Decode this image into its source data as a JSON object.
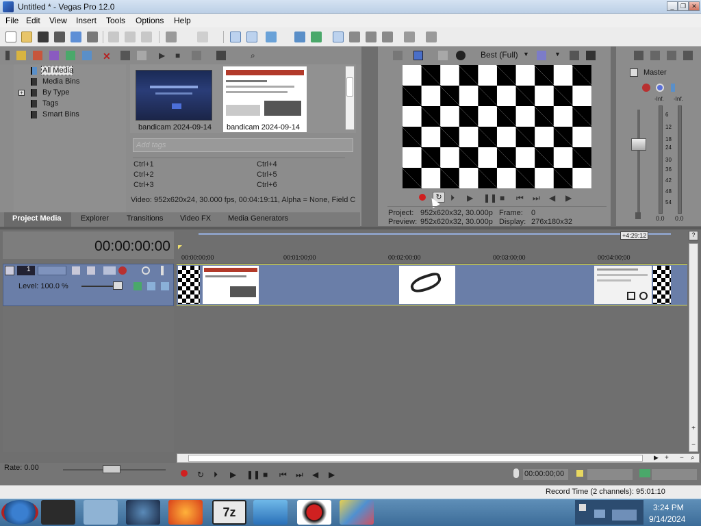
{
  "window": {
    "title": "Untitled * - Vegas Pro 12.0",
    "min": "_",
    "max": "❐",
    "close": "✕"
  },
  "menu": [
    "File",
    "Edit",
    "View",
    "Insert",
    "Tools",
    "Options",
    "Help"
  ],
  "explorer": {
    "tree": [
      "All Media",
      "Media Bins",
      "By Type",
      "Tags",
      "Smart Bins"
    ],
    "expand_glyph": "+",
    "thumbs": [
      {
        "label": "bandicam 2024-09-14"
      },
      {
        "label": "bandicam 2024-09-14"
      }
    ],
    "tags_placeholder": "Add tags",
    "shortcuts": [
      "Ctrl+1",
      "Ctrl+4",
      "Ctrl+2",
      "Ctrl+5",
      "Ctrl+3",
      "Ctrl+6"
    ],
    "info": "Video: 952x620x24, 30.000 fps, 00:04:19:11, Alpha = None, Field C"
  },
  "tabs": [
    "Project Media",
    "Explorer",
    "Transitions",
    "Video FX",
    "Media Generators"
  ],
  "preview": {
    "quality": "Best (Full)",
    "project_label": "Project:",
    "project_value": "952x620x32, 30.000p",
    "preview_label": "Preview:",
    "preview_value": "952x620x32, 30.000p",
    "frame_label": "Frame:",
    "frame_value": "0",
    "display_label": "Display:",
    "display_value": "276x180x32"
  },
  "mixer": {
    "title": "Master",
    "left_peak": "-Inf.",
    "right_peak": "-Inf.",
    "scale": [
      "6",
      "12",
      "18",
      "24",
      "30",
      "36",
      "42",
      "48",
      "54"
    ],
    "left_value": "0.0",
    "right_value": "0.0"
  },
  "timeline": {
    "timecode": "00:00:00:00",
    "end_marker": "+4:29:12",
    "ruler": [
      "00:00:00;00",
      "00:01:00;00",
      "00:02:00;00",
      "00:03:00;00",
      "00:04:00;00"
    ],
    "track_number": "1",
    "level": "Level: 100.0 %",
    "rate": "Rate: 0.00",
    "transport_time": "00:00:00;00",
    "record_time": "Record Time (2 channels): 95:01:10"
  },
  "taskbar": {
    "clock_time": "3:24 PM",
    "clock_date": "9/14/2024"
  },
  "colors": {
    "panel": "#8c8c8c",
    "track": "#6a7ea8",
    "selection": "#bcd2ee",
    "record": "#d02020"
  }
}
